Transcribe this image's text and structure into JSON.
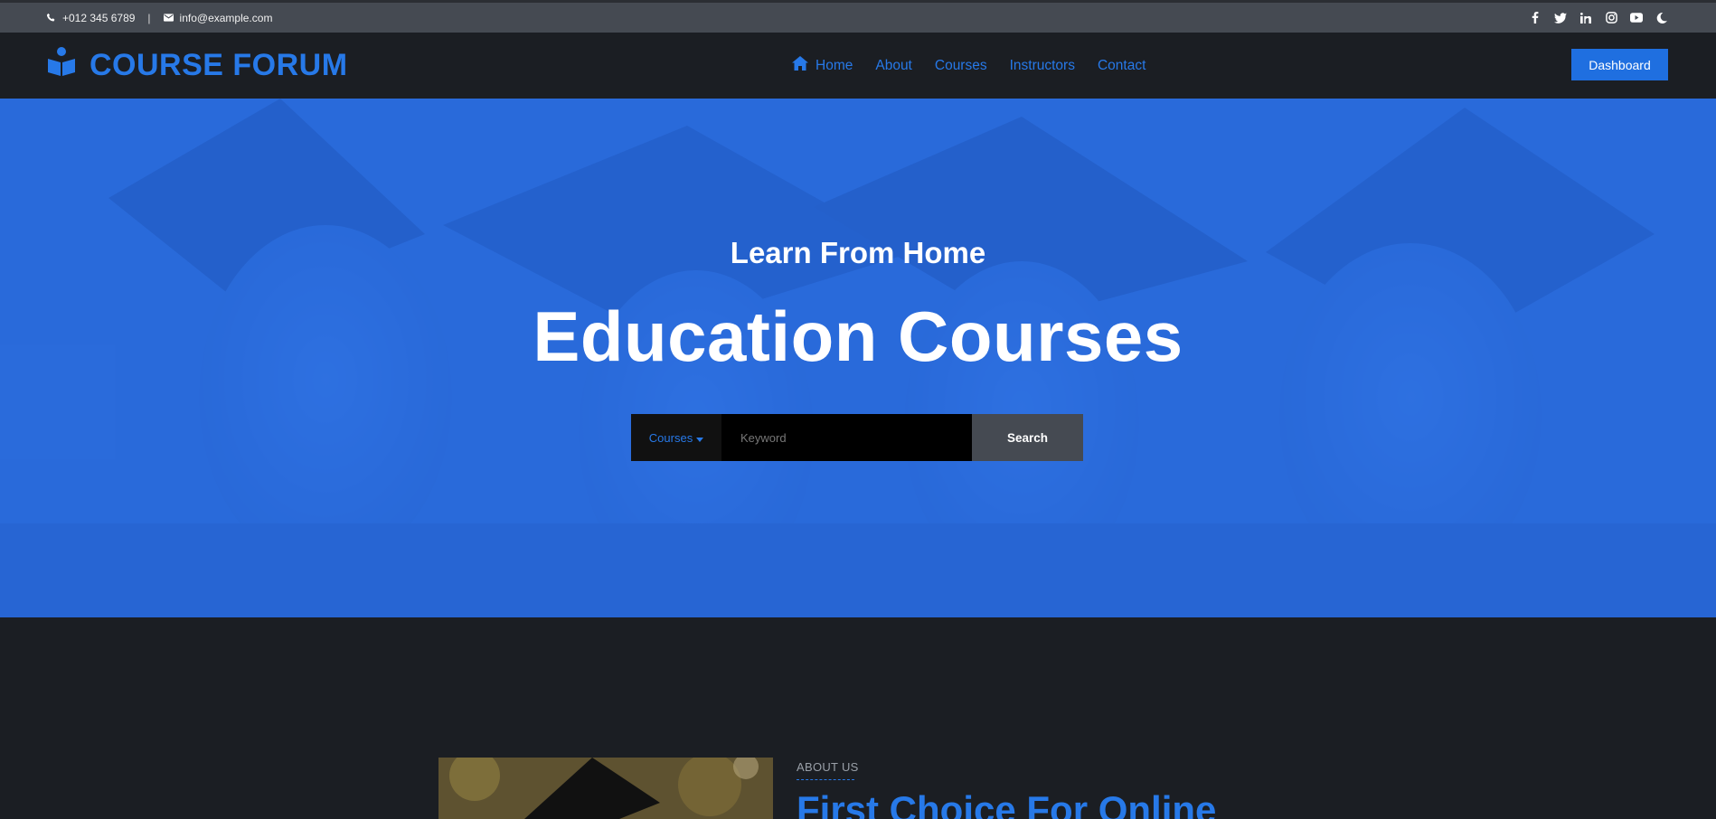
{
  "topbar": {
    "phone": "+012 345 6789",
    "separator": "|",
    "email": "info@example.com",
    "social_icons": [
      "facebook-icon",
      "twitter-icon",
      "linkedin-icon",
      "instagram-icon",
      "youtube-icon",
      "moon-icon"
    ]
  },
  "brand": {
    "name": "COURSE FORUM",
    "icon": "reader-icon",
    "color": "#2779e8"
  },
  "nav": {
    "items": [
      {
        "label": "Home",
        "icon": "home-icon"
      },
      {
        "label": "About"
      },
      {
        "label": "Courses"
      },
      {
        "label": "Instructors"
      },
      {
        "label": "Contact"
      }
    ],
    "dashboard_label": "Dashboard"
  },
  "hero": {
    "subtitle": "Learn From Home",
    "title": "Education Courses",
    "overlay_color": "#2d74e4",
    "search": {
      "dropdown_label": "Courses",
      "placeholder": "Keyword",
      "button_label": "Search"
    }
  },
  "about": {
    "label": "ABOUT US",
    "title": "First Choice For Online"
  }
}
